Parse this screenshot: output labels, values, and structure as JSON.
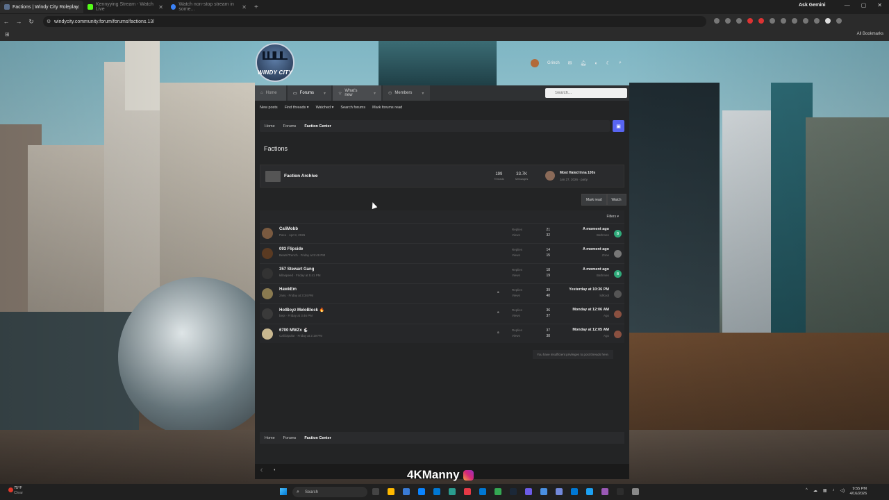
{
  "browser": {
    "tabs": [
      {
        "title": "Factions | Windy City Roleplay",
        "active": true,
        "favicon_color": "#5a6e8c"
      },
      {
        "title": "Kennyying Stream - Watch Live",
        "active": false,
        "favicon_color": "#53fc18"
      },
      {
        "title": "Watch non-stop stream in some...",
        "active": false,
        "favicon_color": "#3b82f6"
      }
    ],
    "new_tab": "+",
    "gemini_label": "Ask Gemini",
    "url": "windycity.community.forum/forums/factions.13/",
    "all_bookmarks": "All Bookmarks"
  },
  "logo": {
    "text": "WINDY CITY"
  },
  "user": {
    "name": "Grinch"
  },
  "nav": {
    "tabs": [
      {
        "label": "Home"
      },
      {
        "label": "Forums"
      },
      {
        "label": "What's new"
      },
      {
        "label": "Members"
      }
    ],
    "search_placeholder": "Search..."
  },
  "subnav": [
    "New posts",
    "Find threads ▾",
    "Watched ▾",
    "Search forums",
    "Mark forums read"
  ],
  "breadcrumb": [
    "Home",
    "Forums",
    "Faction Center"
  ],
  "page_title": "Factions",
  "subforum": {
    "name": "Faction Archive",
    "threads": "199",
    "threads_label": "Threads",
    "messages": "33.7K",
    "messages_label": "Messages",
    "last_post_title": "Most Hated Inna 100s",
    "last_post_meta": "Jan 27, 2026 · party"
  },
  "actions": {
    "mark_read": "Mark read",
    "watch": "Watch"
  },
  "filters_label": "Filters ▾",
  "threads": [
    {
      "title": "CaliMobb",
      "meta": "Paco · Apr 8, 2026",
      "replies": "21",
      "views": "32",
      "last_time": "A moment ago",
      "last_user": "Bathmen",
      "avatar_color": "#7a5a40",
      "last_av_color": "#2faa7a",
      "last_av_letter": "B",
      "locked": false
    },
    {
      "title": "093 Flipside",
      "meta": "Beats/Trench · Friday at 5:49 PM",
      "replies": "14",
      "views": "15",
      "last_time": "A moment ago",
      "last_user": "Zone",
      "avatar_color": "#5a3a22",
      "last_av_color": "#777",
      "last_av_letter": "",
      "locked": false
    },
    {
      "title": "357 Stewart Gang",
      "meta": "killaspeed · Friday at 5:41 PM",
      "replies": "18",
      "views": "19",
      "last_time": "A moment ago",
      "last_user": "Bathmen",
      "avatar_color": "#333",
      "last_av_color": "#2faa7a",
      "last_av_letter": "B",
      "locked": false
    },
    {
      "title": "HawkEm",
      "meta": "zany · Friday at 3:34 PM",
      "replies": "39",
      "views": "40",
      "last_time": "Yesterday at 10:36 PM",
      "last_user": "lolKool",
      "avatar_color": "#8a7a50",
      "last_av_color": "#555",
      "last_av_letter": "",
      "locked": true
    },
    {
      "title": "HotBoyz MeloBlock 🔥",
      "meta": "bepi · Friday at 3:46 PM",
      "replies": "36",
      "views": "37",
      "last_time": "Monday at 12:06 AM",
      "last_user": "Ago",
      "avatar_color": "#3a3a3a",
      "last_av_color": "#8a5040",
      "last_av_letter": "",
      "locked": true
    },
    {
      "title": "6700 MWZx 🐇",
      "meta": "Cali.bipolar · Friday at 2:19 PM",
      "replies": "37",
      "views": "38",
      "last_time": "Monday at 12:05 AM",
      "last_user": "Ago",
      "avatar_color": "#c9b890",
      "last_av_color": "#8a5040",
      "last_av_letter": "",
      "locked": true
    }
  ],
  "labels": {
    "replies": "Replies",
    "views": "Views"
  },
  "no_permission": "You have insufficient privileges to post threads here.",
  "watermark": "4KManny",
  "taskbar": {
    "weather_temp": "75°F",
    "weather_cond": "Clear",
    "search": "Search",
    "time": "9:55 PM",
    "date": "4/16/2026"
  }
}
